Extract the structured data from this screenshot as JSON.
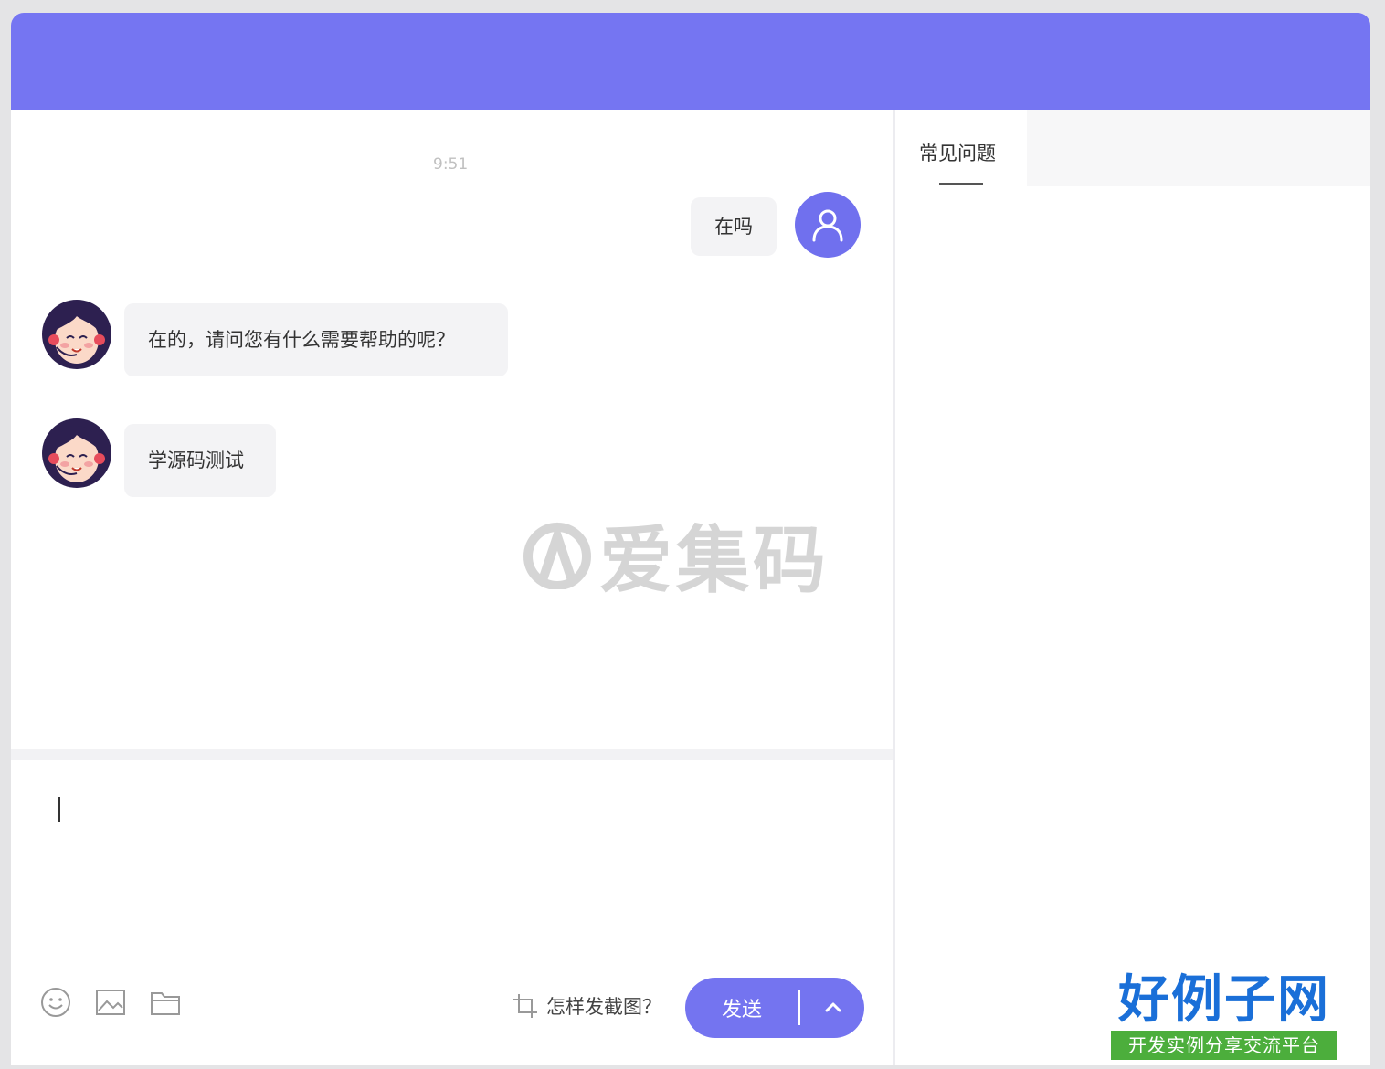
{
  "chat": {
    "timestamp": "9:51",
    "messages": [
      {
        "from": "user",
        "text": "在吗"
      },
      {
        "from": "agent",
        "text": "在的，请问您有什么需要帮助的呢？"
      },
      {
        "from": "agent",
        "text": "学源码测试"
      }
    ]
  },
  "sidebar": {
    "tabs": [
      {
        "label": "常见问题",
        "active": true
      }
    ]
  },
  "composer": {
    "input_value": "",
    "toolbar_icons": [
      "emoji-icon",
      "image-icon",
      "folder-icon"
    ],
    "screenshot_help": "怎样发截图？",
    "send_label": "发送"
  },
  "watermarks": {
    "center_logo": "爱集码",
    "brand_main": "好例子网",
    "brand_sub": "开发实例分享交流平台"
  },
  "colors": {
    "accent": "#7575f2",
    "bubble": "#f3f3f5",
    "brand_blue": "#1a6fd8",
    "brand_green": "#4cae3c"
  }
}
